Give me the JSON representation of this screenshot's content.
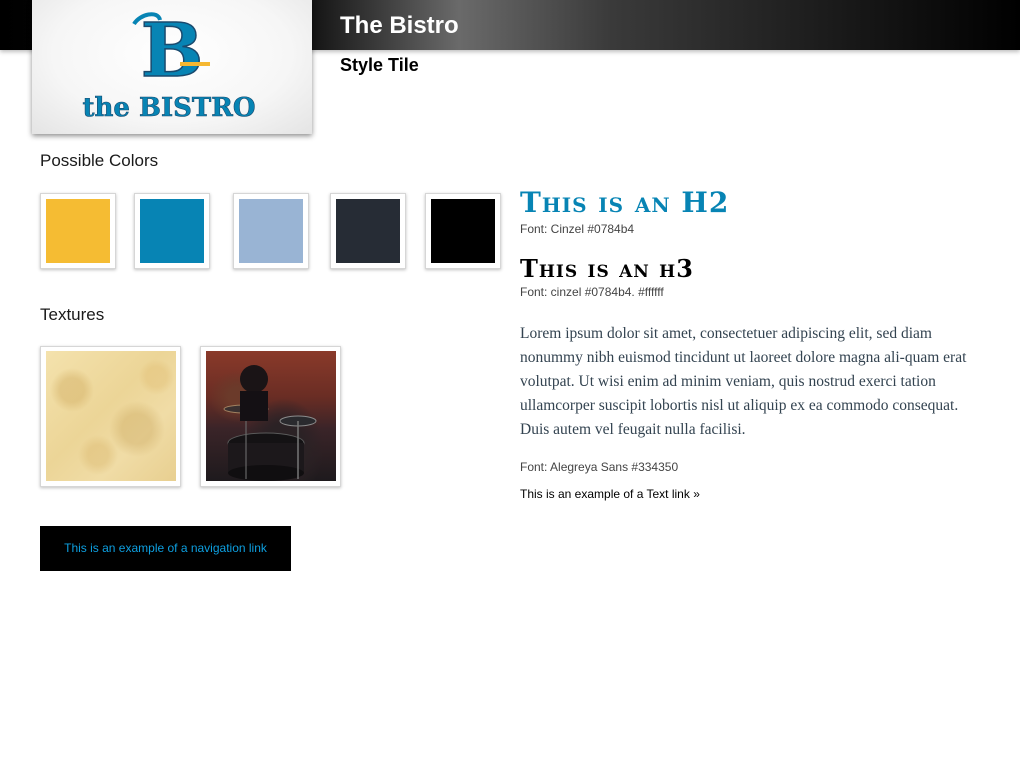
{
  "header": {
    "title": "The Bistro",
    "subtitle": "Style Tile"
  },
  "logo": {
    "letter": "B",
    "wordmark": "the BISTRO",
    "colors": {
      "primary": "#0784b4",
      "accent": "#f5b731",
      "outline": "#1a4a6e"
    }
  },
  "colors_section": {
    "title": "Possible Colors",
    "swatches": [
      "#f5bc33",
      "#0784b4",
      "#99b4d4",
      "#262c35",
      "#000000"
    ]
  },
  "textures_section": {
    "title": "Textures",
    "items": [
      "paper-texture",
      "drum-kit-photo"
    ]
  },
  "navigation": {
    "link_text": "This is an example of a navigation link",
    "background": "#000000",
    "text_color": "#0d9fe0"
  },
  "typography": {
    "h2_sample": "This is an H2",
    "h2_note": "Font: Cinzel  #0784b4",
    "h3_sample": "This is an h3",
    "h3_note": "Font: cinzel  #0784b4. #ffffff",
    "body_sample": "Lorem ipsum dolor sit amet, consectetuer adipiscing elit, sed diam nonummy nibh euismod tincidunt ut laoreet dolore magna ali-quam erat volutpat. Ut wisi enim ad minim veniam, quis nostrud exerci tation ullamcorper suscipit lobortis nisl ut aliquip ex ea commodo consequat. Duis autem vel feugait nulla facilisi.",
    "body_note": "Font: Alegreya Sans #334350",
    "text_link": "This is an example of a Text link »"
  }
}
